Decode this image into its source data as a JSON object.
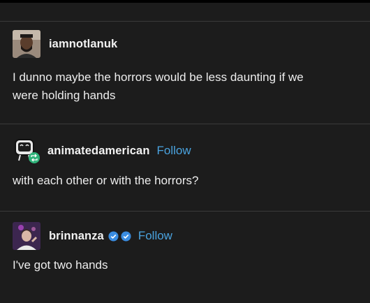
{
  "posts": [
    {
      "username": "iamnotlanuk",
      "text_line1": "I dunno maybe the horrors would be less daunting if we",
      "text_line2": "were holding hands",
      "avatar_icon": "profile-photo-man"
    },
    {
      "username": "animatedamerican",
      "follow_label": "Follow",
      "text": "with each other or with the horrors?",
      "avatar_icon": "tv-character-icon",
      "reblog_icon": "reblog-badge-icon"
    },
    {
      "username": "brinnanza",
      "follow_label": "Follow",
      "text": "I've got two hands",
      "avatar_icon": "profile-photo-person",
      "badges": [
        "verified-badge-icon",
        "verified-badge-icon"
      ]
    }
  ],
  "colors": {
    "background": "#1c1c1c",
    "divider": "#3a3a3a",
    "follow": "#4aa3df",
    "badge": "#3a8ce0",
    "reblog": "#2fb37a"
  }
}
